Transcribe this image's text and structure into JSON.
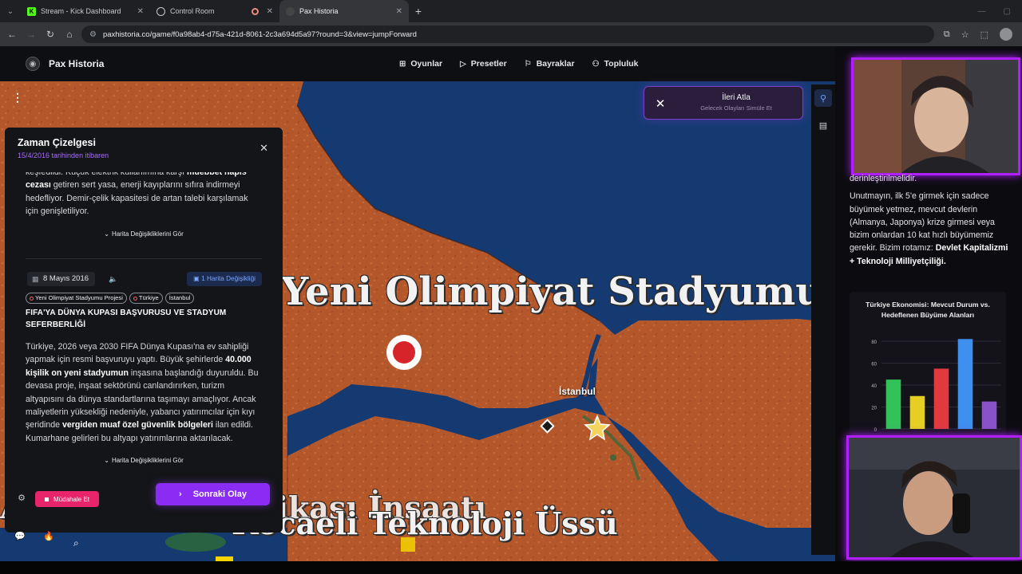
{
  "browser": {
    "tabs": [
      {
        "title": "Stream - Kick Dashboard",
        "favicon": "kick-icon",
        "active": false
      },
      {
        "title": "Control Room",
        "favicon": "globe-icon",
        "active": false
      },
      {
        "title": "Pax Historia",
        "favicon": "pax-icon",
        "active": true
      }
    ],
    "url": "paxhistoria.co/game/f0a98ab4-d75a-421d-8061-2c3a694d5a97?round=3&view=jumpForward"
  },
  "app": {
    "brand": "Pax Historia",
    "nav": [
      {
        "label": "Oyunlar",
        "icon": "gamepad-icon"
      },
      {
        "label": "Presetler",
        "icon": "play-icon"
      },
      {
        "label": "Bayraklar",
        "icon": "flag-icon"
      },
      {
        "label": "Topluluk",
        "icon": "people-icon"
      }
    ],
    "skip_banner": {
      "title": "İleri Atla",
      "subtitle": "Gelecek Olayları Simüle Et"
    },
    "timeline": {
      "title": "Zaman Çizelgesi",
      "subtitle": "15/4/2016 tarihinden itibaren",
      "prev_event": {
        "text_1": "keşfedildi. Küçük elektrik kullanımına karşı ",
        "bold_1": "müebbet hapis cezası",
        "text_2": " getiren sert yasa, enerji kayıplarını sıfıra indirmeyi hedefliyor. Demir-çelik kapasitesi de artan talebi karşılamak için genişletiliyor.",
        "map_changes": "Harita Değişikliklerini Gör"
      },
      "event": {
        "date": "8 Mayıs 2016",
        "map_change_badge": "1 Harita Değişikliği",
        "tags": [
          "Yeni Olimpiyat Stadyumu Projesi",
          "Türkiye",
          "İstanbul"
        ],
        "title": "FIFA'YA DÜNYA KUPASI BAŞVURUSU VE STADYUM SEFERBERLİĞİ",
        "p1": "Türkiye, 2026 veya 2030 FIFA Dünya Kupası'na ev sahipliği yapmak için resmi başvuruyu yaptı. Büyük şehirlerde ",
        "b1": "40.000 kişilik on yeni stadyumun",
        "p2": " inşasına başlandığı duyuruldu. Bu devasa proje, inşaat sektörünü canlandırırken, turizm altyapısını da dünya standartlarına taşımayı amaçlıyor. Ancak maliyetlerin yüksekliği nedeniyle, yabancı yatırımcılar için kıyı şeridinde ",
        "b2": "vergiden muaf özel güvenlik bölgeleri",
        "p3": " ilan edildi. Kumarhane gelirleri bu altyapı yatırımlarına aktarılacak.",
        "map_changes": "Harita Değişikliklerini Gör"
      }
    },
    "controls": {
      "intervene": "Müdahale Et",
      "next_event": "Sonraki Olay"
    },
    "map_labels": {
      "stadium": "Yeni Olimpiyat Stadyumu Projesi",
      "factory": "Ankara Çip Fabrikası İnşaatı",
      "tech_base": "Kocaeli Teknoloji Üssü",
      "istanbul": "İstanbul"
    },
    "colors": {
      "land": "#b4582c",
      "sea": "#153a72",
      "accent": "#8b2cf5"
    }
  },
  "stream": {
    "text_top": "derinleştirilmelidir.",
    "text_p1": "Unutmayın, ilk 5'e girmek için sadece büyümek yetmez, mevcut devlerin (Almanya, Japonya) krize girmesi veya bizim onlardan 10 kat hızlı büyümemiz gerekir. Bizim rotamız: ",
    "text_bold": "Devlet Kapitalizmi + Teknoloji Milliyetçiliği.",
    "chart_title": "Türkiye Ekonomisi: Mevcut Durum vs. Hedeflenen Büyüme Alanları"
  },
  "chart_data": {
    "type": "bar",
    "title": "Türkiye Ekonomisi: Mevcut Durum vs. Hedeflenen Büyüme Alanları",
    "ylim": [
      0,
      80
    ],
    "yticks": [
      "80",
      "60",
      "40",
      "20",
      "0"
    ],
    "values": [
      45,
      30,
      55,
      82,
      25
    ],
    "colors": [
      "#33c15a",
      "#e6cf22",
      "#e2393f",
      "#3d8ff0",
      "#8a52c8"
    ]
  }
}
